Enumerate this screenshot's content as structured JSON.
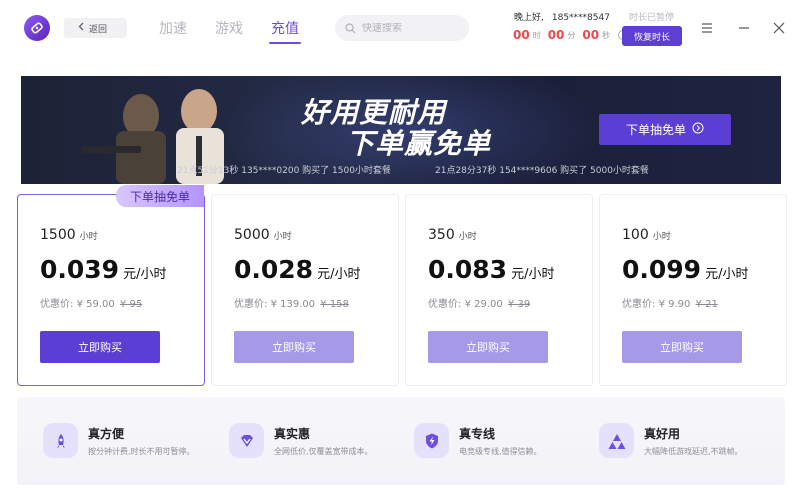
{
  "header": {
    "back_label": "返回",
    "tabs": [
      {
        "label": "加速",
        "active": false
      },
      {
        "label": "游戏",
        "active": false
      },
      {
        "label": "充值",
        "active": true
      }
    ],
    "search_placeholder": "快速搜索",
    "greeting": "晚上好,",
    "phone": "185****8547",
    "paused_label": "时长已暂停",
    "timer": {
      "hours": "00",
      "hours_unit": "时",
      "minutes": "00",
      "minutes_unit": "分",
      "seconds": "00",
      "seconds_unit": "秒"
    },
    "resume_label": "恢复时长"
  },
  "banner": {
    "title": "好用更耐用",
    "subtitle": "下单赢免单",
    "cta_label": "下单抽免单",
    "tickers": [
      "21点51分13秒 135****0200 购买了 1500小时套餐",
      "21点28分37秒 154****9606 购买了 5000小时套餐"
    ]
  },
  "plans": [
    {
      "hours": "1500",
      "hours_unit": "小时",
      "price": "0.039",
      "price_unit": "元/小时",
      "disc_label": "优惠价:",
      "disc_price": "¥ 59.00",
      "orig_price": "¥ 95",
      "buy_label": "立即购买",
      "badge": "下单抽免单"
    },
    {
      "hours": "5000",
      "hours_unit": "小时",
      "price": "0.028",
      "price_unit": "元/小时",
      "disc_label": "优惠价:",
      "disc_price": "¥ 139.00",
      "orig_price": "¥ 158",
      "buy_label": "立即购买"
    },
    {
      "hours": "350",
      "hours_unit": "小时",
      "price": "0.083",
      "price_unit": "元/小时",
      "disc_label": "优惠价:",
      "disc_price": "¥ 29.00",
      "orig_price": "¥ 39",
      "buy_label": "立即购买"
    },
    {
      "hours": "100",
      "hours_unit": "小时",
      "price": "0.099",
      "price_unit": "元/小时",
      "disc_label": "优惠价:",
      "disc_price": "¥ 9.90",
      "orig_price": "¥ 21",
      "buy_label": "立即购买"
    }
  ],
  "features": [
    {
      "title": "真方便",
      "desc": "按分钟计费,时长不用可暂停。",
      "icon": "rocket-icon"
    },
    {
      "title": "真实惠",
      "desc": "全网低价,仅覆盖宽带成本。",
      "icon": "diamond-icon"
    },
    {
      "title": "真专线",
      "desc": "电竞级专线,值得信赖。",
      "icon": "lightning-shield-icon"
    },
    {
      "title": "真好用",
      "desc": "大幅降低游戏延迟,不跳帧。",
      "icon": "triangles-icon"
    }
  ],
  "colors": {
    "accent": "#5b3fd4",
    "accent_light": "#a599e8",
    "timer_red": "#f0464d"
  }
}
